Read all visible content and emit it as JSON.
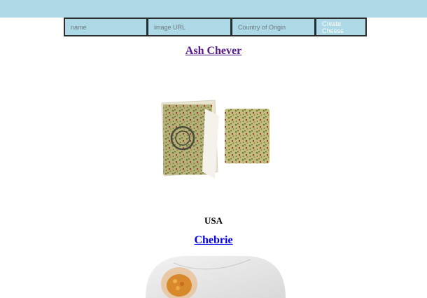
{
  "form": {
    "name_placeholder": "name",
    "image_placeholder": "image URL",
    "country_placeholder": "Country of Origin",
    "create_label": "Create Cheese"
  },
  "cheeses": [
    {
      "name": "Ash Chever",
      "country": "USA"
    },
    {
      "name": "Chebrie"
    }
  ],
  "colors": {
    "header_bg": "#add8e6",
    "visited_link": "#551a8b",
    "link": "#0000ee"
  }
}
